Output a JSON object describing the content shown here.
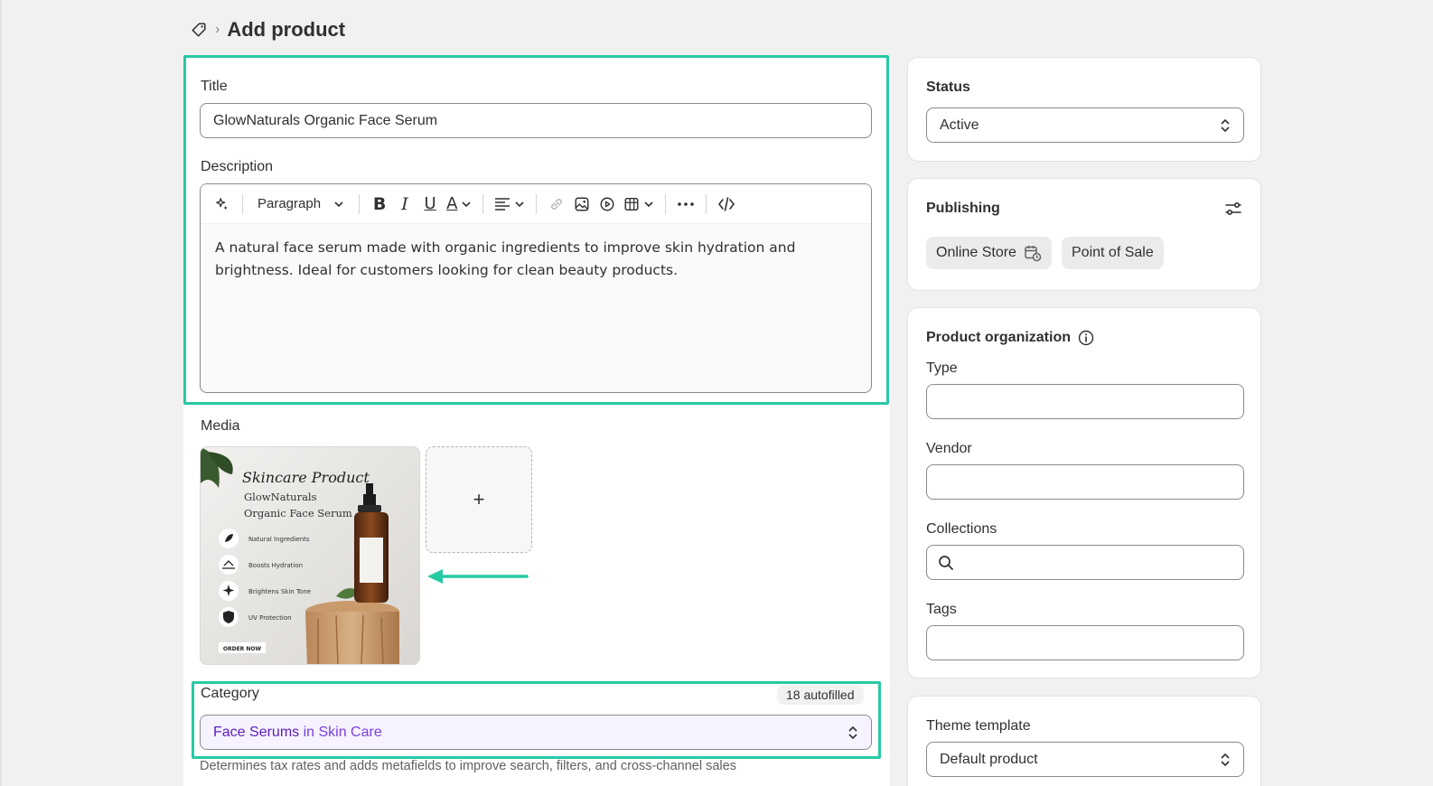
{
  "header": {
    "breadcrumb_icon": "tag-icon",
    "page_title": "Add product"
  },
  "product": {
    "title_label": "Title",
    "title_value": "GlowNaturals Organic Face Serum",
    "description_label": "Description",
    "toolbar": {
      "paragraph_label": "Paragraph"
    },
    "description_text": "A natural face serum made with organic ingredients to improve skin hydration and brightness. Ideal for customers looking for clean beauty products.",
    "media_label": "Media",
    "media_image": {
      "heading": "Skincare Product",
      "brand": "GlowNaturals",
      "product": "Organic Face Serum",
      "features": [
        "Natural Ingredients",
        "Boosts Hydration",
        "Brightens Skin Tone",
        "UV Protection"
      ],
      "cta": "ORDER NOW"
    },
    "media_add_label": "+",
    "category_label": "Category",
    "category_badge": "18 autofilled",
    "category_name": "Face Serums",
    "category_connector": " in ",
    "category_parent": "Skin Care",
    "category_help": "Determines tax rates and adds metafields to improve search, filters, and cross-channel sales"
  },
  "status": {
    "title": "Status",
    "value": "Active"
  },
  "publishing": {
    "title": "Publishing",
    "channels": [
      "Online Store",
      "Point of Sale"
    ]
  },
  "organization": {
    "title": "Product organization",
    "type_label": "Type",
    "vendor_label": "Vendor",
    "collections_label": "Collections",
    "tags_label": "Tags"
  },
  "theme": {
    "title": "Theme template",
    "value": "Default product"
  },
  "colors": {
    "highlight": "#27c9a4",
    "category_text": "#5c1cc2",
    "background": "#f1f1f1"
  }
}
